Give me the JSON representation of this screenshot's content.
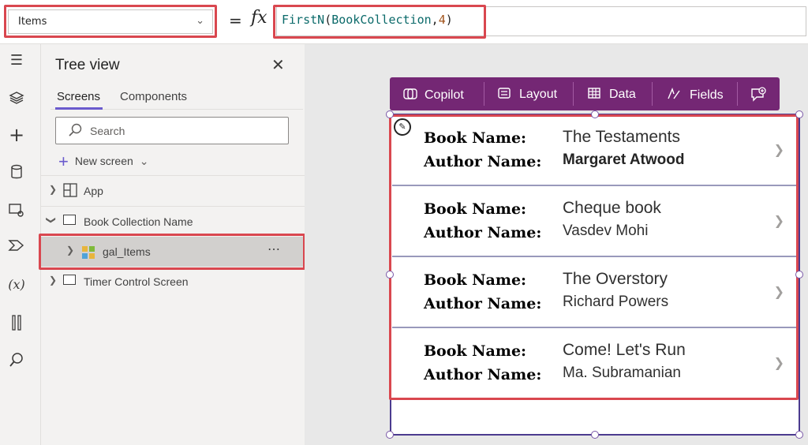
{
  "formula_bar": {
    "property": "Items",
    "eq": "=",
    "fx": "fx",
    "formula_fn": "FirstN",
    "formula_open": "(",
    "formula_arg": "BookCollection",
    "formula_comma": ",",
    "formula_num": "4",
    "formula_close": ")"
  },
  "tree": {
    "title": "Tree view",
    "tabs": {
      "screens": "Screens",
      "components": "Components"
    },
    "search_placeholder": "Search",
    "new_screen": "New screen",
    "items": [
      {
        "label": "App"
      },
      {
        "label": "Book Collection Name"
      },
      {
        "label": "gal_Items"
      },
      {
        "label": "Timer Control Screen"
      }
    ]
  },
  "toolbar": {
    "copilot": "Copilot",
    "layout": "Layout",
    "data": "Data",
    "fields": "Fields"
  },
  "gallery": {
    "book_label": "Book Name:",
    "author_label": "Author Name:",
    "items": [
      {
        "book": "The Testaments",
        "author": "Margaret Atwood"
      },
      {
        "book": "Cheque book",
        "author": "Vasdev Mohi"
      },
      {
        "book": "The Overstory",
        "author": "Richard Powers"
      },
      {
        "book": "Come! Let's Run",
        "author": "Ma. Subramanian"
      }
    ]
  },
  "colors": {
    "accent": "#742774",
    "highlight": "#d9474f",
    "selection": "#d2d0ce"
  }
}
